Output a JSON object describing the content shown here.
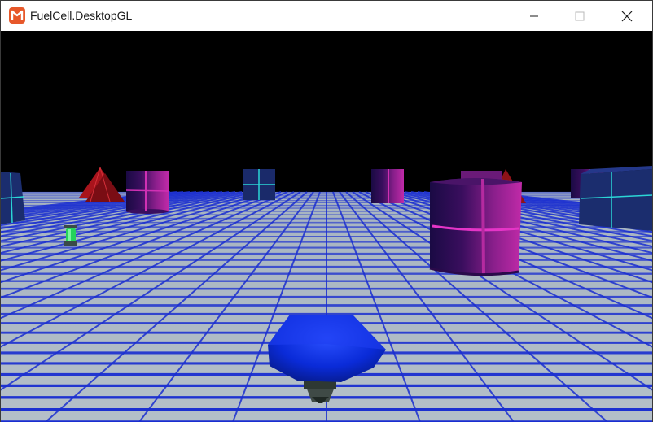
{
  "window": {
    "title": "FuelCell.DesktopGL",
    "app_icon": "monogame-logo-icon",
    "controls": [
      "minimize-icon",
      "maximize-icon",
      "close-icon"
    ]
  },
  "colors": {
    "sky": "#000000",
    "floor": "#a9b5bf",
    "grid": "#1a2ed1",
    "player": "#0a2bd8",
    "barrier_magenta": "#c616a6",
    "barrier_cyan": "#2bd6d6",
    "pyramid": "#a8141c",
    "fuel_cell": "#25d35a",
    "logo": "#e7582a"
  },
  "scene": {
    "player": "blue-disc-craft",
    "objects": [
      "magenta-cylinder-barrier",
      "cyan-cube-barrier",
      "red-pyramid-barrier",
      "green-fuel-cell"
    ]
  }
}
